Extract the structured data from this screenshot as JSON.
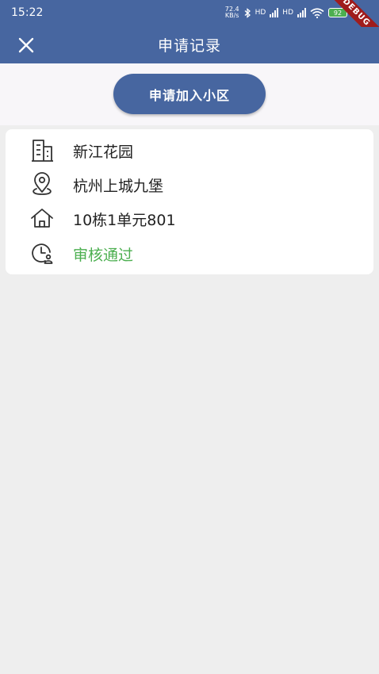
{
  "status_bar": {
    "time": "15:22",
    "net_speed_value": "72.4",
    "net_speed_unit": "KB/s",
    "hd1": "HD",
    "hd2": "HD",
    "battery": "92"
  },
  "debug_banner": "DEBUG",
  "app_bar": {
    "title": "申请记录"
  },
  "join_button": {
    "label": "申请加入小区"
  },
  "application": {
    "community": "新江花园",
    "address": "杭州上城九堡",
    "unit": "10栋1单元801",
    "status": "审核通过",
    "status_color": "#4caf50"
  },
  "theme": {
    "primary": "#4766a0",
    "background": "#eeeeee"
  }
}
